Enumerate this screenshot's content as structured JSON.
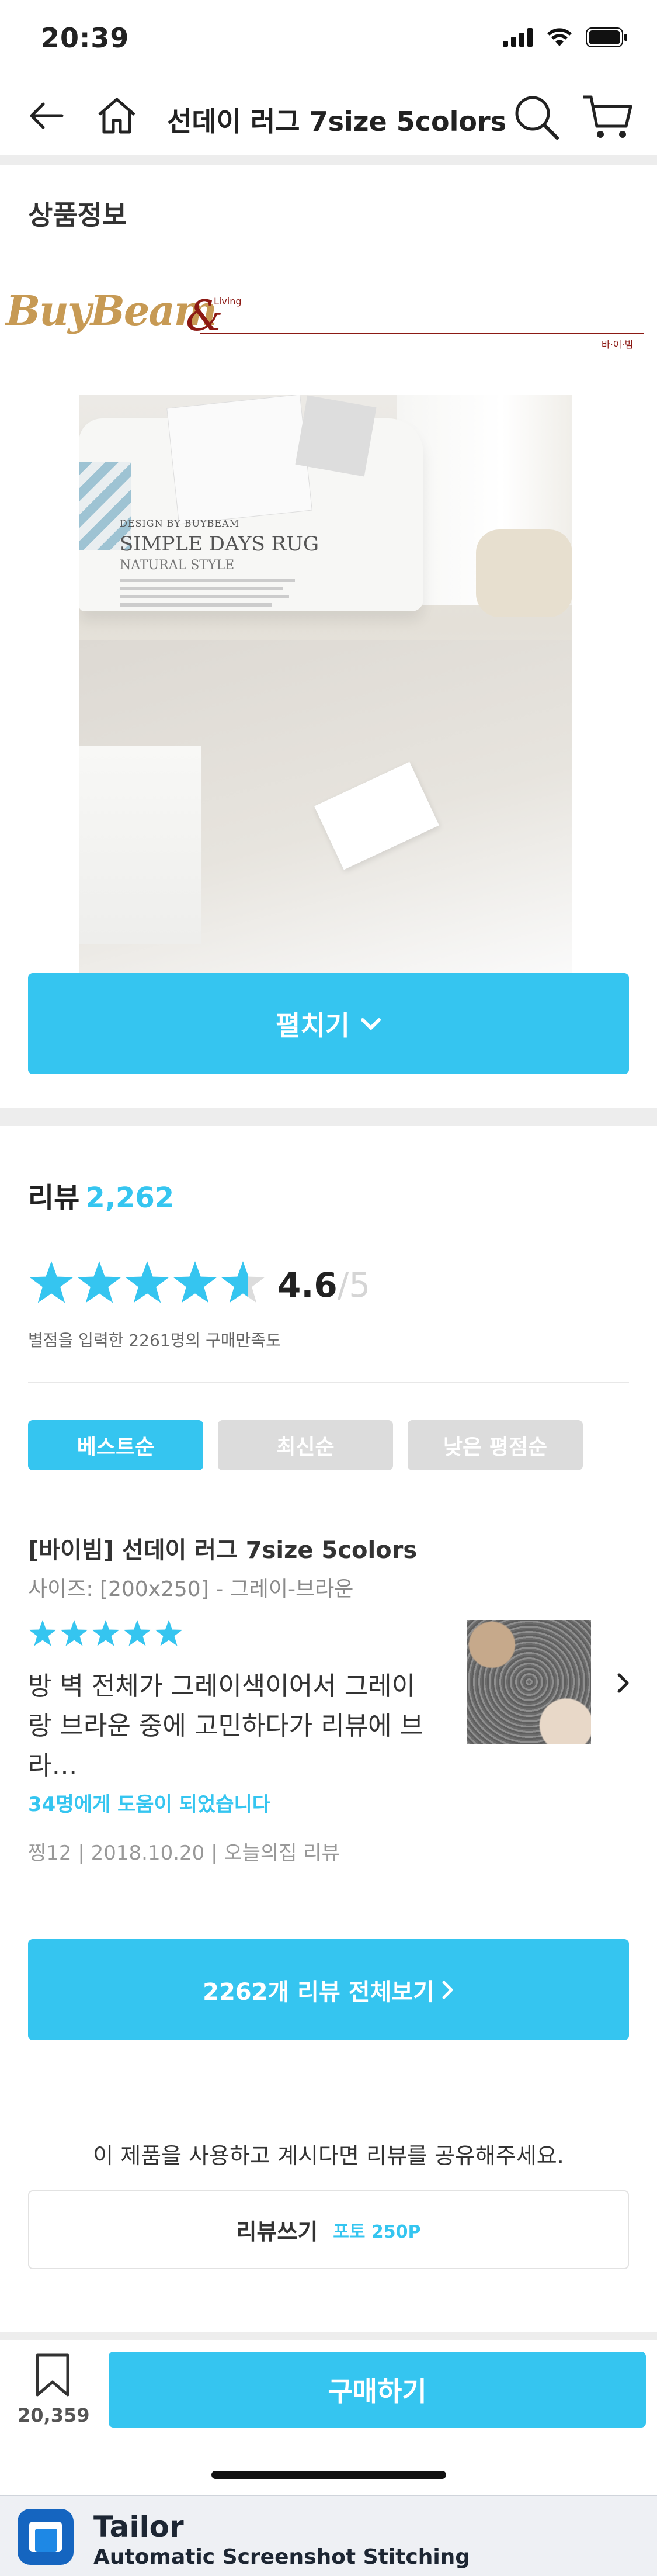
{
  "status_bar": {
    "time": "20:39"
  },
  "header": {
    "title": "선데이 러그 7size 5colors"
  },
  "product_info": {
    "section_title": "상품정보",
    "brand": {
      "logo_text": "BuyBeam",
      "amp": "&",
      "living": "Living",
      "tag": "바·이·빔"
    },
    "image": {
      "design_by": "DESIGN BY BUYBEAM",
      "product_name": "SIMPLE DAYS RUG",
      "style": "NATURAL STYLE"
    },
    "expand_label": "펼치기"
  },
  "reviews": {
    "title": "리뷰",
    "count": "2,262",
    "average": "4.6",
    "average_of": "/5",
    "rating_value": 4.6,
    "rating_sub": "별점을 입력한 2261명의 구매만족도",
    "sort_tabs": [
      {
        "label": "베스트순",
        "active": true
      },
      {
        "label": "최신순",
        "active": false
      },
      {
        "label": "낮은 평점순",
        "active": false
      }
    ],
    "top_review": {
      "title": "[바이빔] 선데이 러그 7size 5colors",
      "option": "사이즈: [200x250] - 그레이-브라운",
      "stars": 5,
      "body": "방 벽 전체가 그레이색이어서 그레이랑 브라운 중에 고민하다가 리뷰에 브라…",
      "helpful": "34명에게 도움이 되었습니다",
      "meta": "찡12 | 2018.10.20 | 오늘의집 리뷰"
    },
    "view_all": "2262개 리뷰 전체보기"
  },
  "share": {
    "prompt": "이 제품을 사용하고 계시다면 리뷰를 공유해주세요.",
    "write_label": "리뷰쓰기",
    "point_label": "포토 250P"
  },
  "bottom_bar": {
    "bookmark_count": "20,359",
    "buy_label": "구매하기"
  },
  "tailor": {
    "name": "Tailor",
    "subtitle": "Automatic Screenshot Stitching"
  },
  "colors": {
    "accent": "#35c5f0",
    "star": "#35c5f0",
    "disabled": "#dcdcdc"
  }
}
